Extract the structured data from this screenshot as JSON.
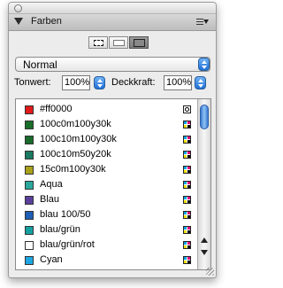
{
  "panel": {
    "title": "Farben"
  },
  "mode": {
    "selected": "Normal"
  },
  "tonwert": {
    "label": "Tonwert:",
    "value": "100%"
  },
  "deckkraft": {
    "label": "Deckkraft:",
    "value": "100%"
  },
  "swatches": [
    {
      "name": "#ff0000",
      "color": "#e01b1b",
      "type": "spot"
    },
    {
      "name": "100c0m100y30k",
      "color": "#1b6e2a",
      "type": "process"
    },
    {
      "name": "100c10m100y30k",
      "color": "#1a6a2c",
      "type": "process"
    },
    {
      "name": "100c10m50y20k",
      "color": "#1c7a62",
      "type": "process"
    },
    {
      "name": "15c0m100y30k",
      "color": "#a8a11a",
      "type": "process"
    },
    {
      "name": "Aqua",
      "color": "#2aa89c",
      "type": "process"
    },
    {
      "name": "Blau",
      "color": "#5a3f9c",
      "type": "process"
    },
    {
      "name": "blau 100/50",
      "color": "#1f5fb5",
      "type": "process"
    },
    {
      "name": "blau/grün",
      "color": "#14a0a0",
      "type": "process"
    },
    {
      "name": "blau/grün/rot",
      "color": "#ffffff",
      "type": "process"
    },
    {
      "name": "Cyan",
      "color": "#1ea6e3",
      "type": "process"
    }
  ]
}
